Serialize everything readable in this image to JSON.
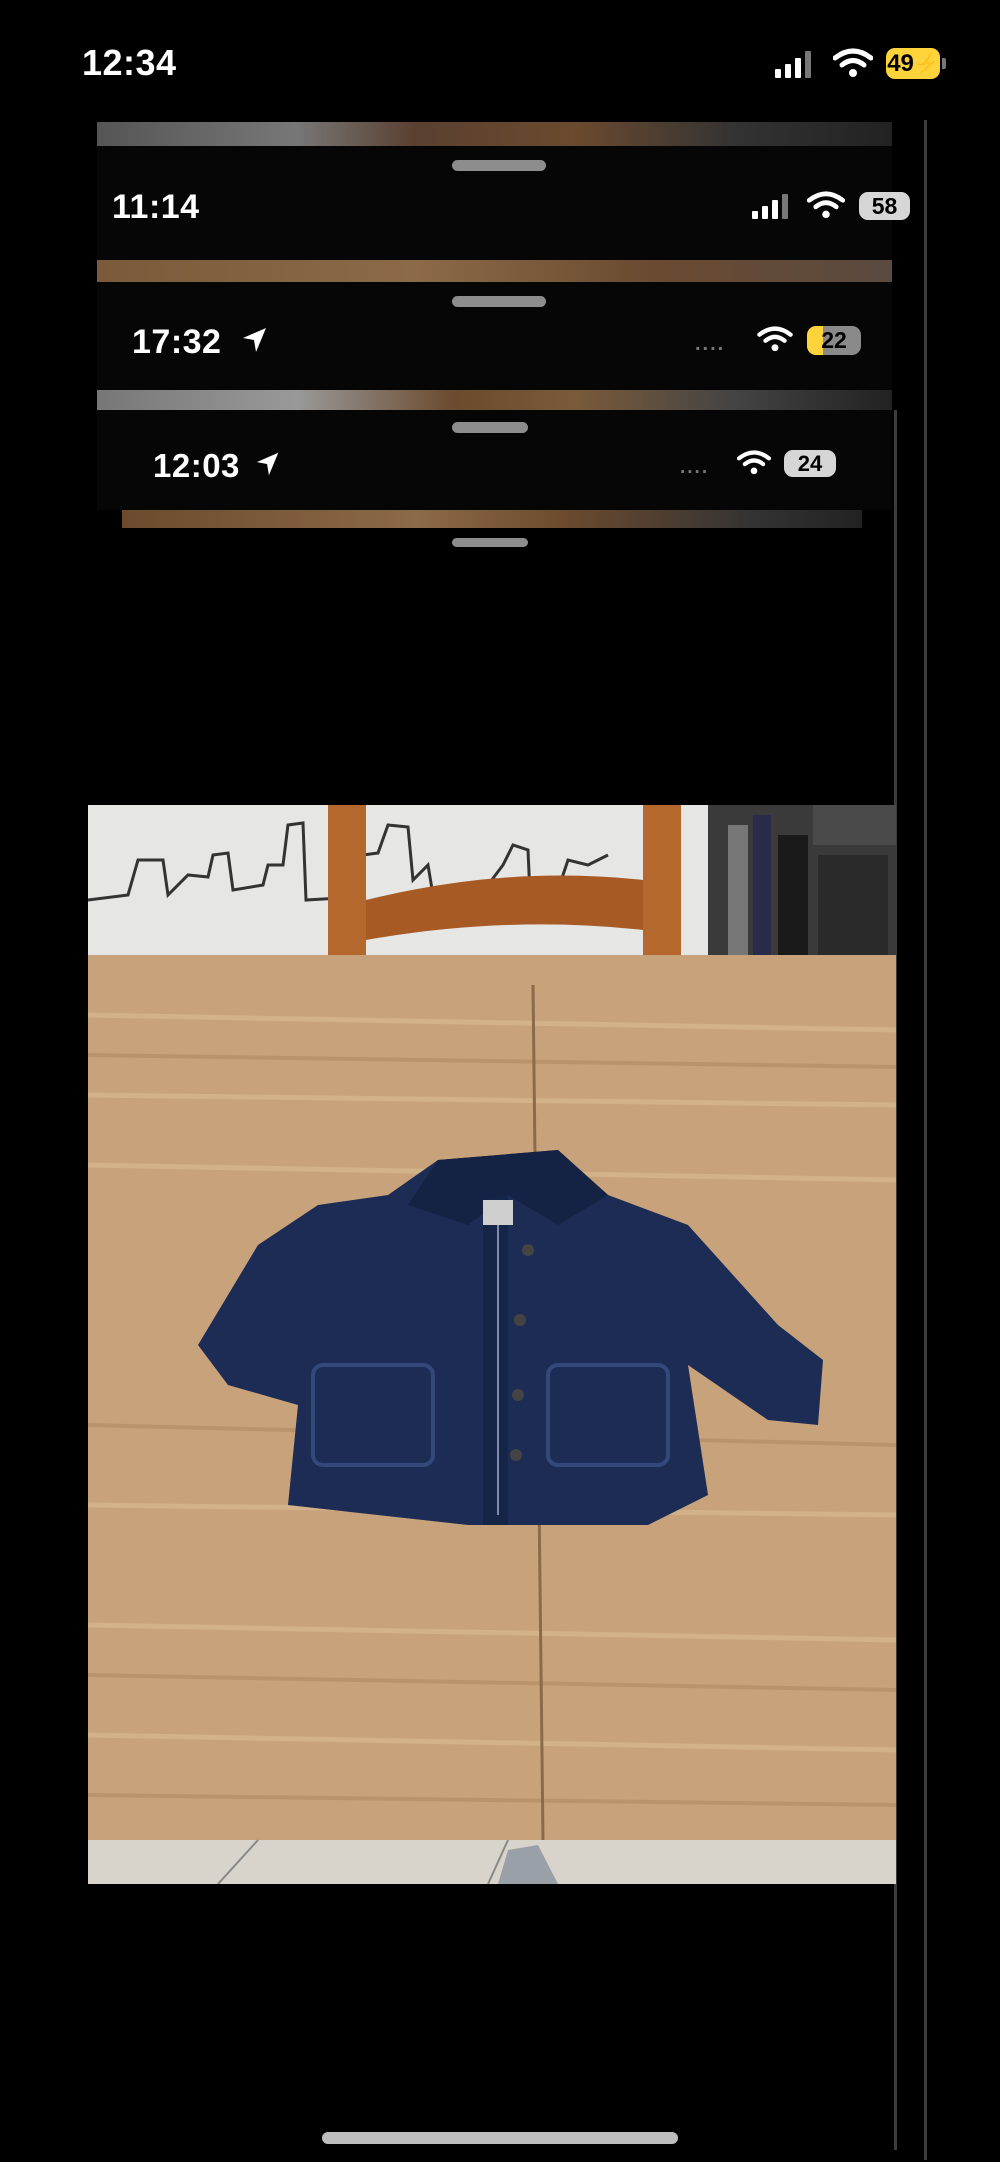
{
  "main_status": {
    "time": "12:34",
    "battery": "49"
  },
  "stack": [
    {
      "time": "11:14",
      "battery": "58",
      "battery_color": "#d6d6d6"
    },
    {
      "time": "17:32",
      "battery": "22",
      "battery_color": "#ffd43b"
    },
    {
      "time": "12:03",
      "battery": "24",
      "battery_color": "#d6d6d6"
    }
  ],
  "colors": {
    "battery_main": "#ffd43b",
    "accent_yellow": "#ffd43b"
  },
  "icons": [
    "signal-icon",
    "wifi-icon",
    "battery-icon",
    "location-arrow-icon",
    "charging-bolt-icon"
  ]
}
